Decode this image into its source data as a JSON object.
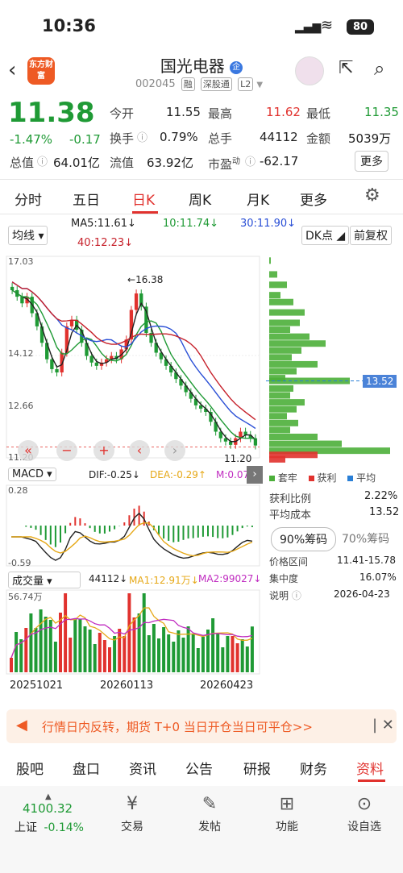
{
  "status": {
    "time": "10:36",
    "battery": "80"
  },
  "header": {
    "logo_text": "东方财富",
    "title": "国光电器",
    "title_badge": "企",
    "code": "002045",
    "tags": [
      "融",
      "深股通",
      "L2"
    ]
  },
  "quote": {
    "price": "11.38",
    "change_pct": "-1.47%",
    "change": "-0.17",
    "open_label": "今开",
    "open": "11.55",
    "high_label": "最高",
    "high": "11.62",
    "low_label": "最低",
    "low": "11.35",
    "turnover_label": "换手",
    "turnover": "0.79%",
    "volume_label": "总手",
    "volume": "44112",
    "amount_label": "金额",
    "amount": "5039万",
    "mcap_label": "总值",
    "mcap": "64.01亿",
    "float_label": "流值",
    "float": "63.92亿",
    "pe_label": "市盈",
    "pe_sup": "动",
    "pe": "-62.17",
    "more": "更多"
  },
  "tabs": [
    "分时",
    "五日",
    "日K",
    "周K",
    "月K",
    "更多"
  ],
  "active_tab": "日K",
  "ma_bar": {
    "select": "均线",
    "ma5": "MA5:11.61↓",
    "ma10": "10:11.74↓",
    "ma30": "30:11.90↓",
    "ma40": "40:12.23↓",
    "dk": "DK点",
    "adjust": "前复权"
  },
  "kline": {
    "y_top": "17.03",
    "y_mid": "14.12",
    "y_low": "12.66",
    "y_bot": "11.20",
    "peak_label": "16.38",
    "low_label": "11.20"
  },
  "macd": {
    "select": "MACD",
    "dif": "DIF:-0.25↓",
    "dea": "DEA:-0.29↑",
    "m": "M:0.07",
    "y_top": "0.28",
    "y_bot": "-0.59"
  },
  "vol": {
    "select": "成交量",
    "v": "44112↓",
    "ma1": "MA1:12.91万↓",
    "ma2": "MA2:99027↓",
    "y_top": "56.74万",
    "dates": [
      "20251021",
      "20260113",
      "20260423"
    ]
  },
  "chip": {
    "price_label": "13.52",
    "legend": [
      "套牢",
      "获利",
      "平均"
    ],
    "profit_label": "获利比例",
    "profit": "2.22%",
    "avg_label": "平均成本",
    "avg": "13.52",
    "tab90": "90%筹码",
    "tab70": "70%筹码",
    "range_label": "价格区间",
    "range": "11.41-15.78",
    "conc_label": "集中度",
    "conc": "16.07%",
    "note_label": "说明",
    "note": "2026-04-23"
  },
  "colors": {
    "up": "#e1322e",
    "down": "#1f9a35",
    "ma5": "#222222",
    "ma10": "#e6a817",
    "ma30": "#2a4fd6",
    "ma40": "#c6202a",
    "chip": "#4caf3a",
    "avg": "#2a7fd6"
  },
  "banner": {
    "text": "行情日内反转，期货 T+0 当日开仓当日可平仓>>"
  },
  "bottom_tabs": [
    "股吧",
    "盘口",
    "资讯",
    "公告",
    "研报",
    "财务",
    "资料"
  ],
  "active_bottom": "资料",
  "dock": {
    "index_value": "4100.32",
    "index_name": "上证",
    "index_change": "-0.14%",
    "items": [
      "交易",
      "发帖",
      "功能",
      "设自选"
    ]
  },
  "chart_data": {
    "type": "candlestick",
    "title": "",
    "ylim": [
      11.2,
      17.03
    ],
    "x_ticks": [
      "20251021",
      "20260113",
      "20260423"
    ],
    "close_path": [
      16.1,
      15.9,
      15.7,
      15.9,
      15.4,
      15.0,
      14.5,
      14.0,
      13.7,
      13.6,
      14.2,
      15.0,
      15.2,
      14.9,
      14.5,
      14.1,
      13.9,
      13.8,
      13.9,
      14.0,
      14.1,
      14.0,
      14.3,
      14.6,
      15.5,
      16.0,
      15.6,
      14.8,
      14.5,
      14.2,
      14.0,
      13.8,
      13.6,
      13.4,
      13.2,
      13.0,
      12.8,
      12.6,
      12.5,
      12.4,
      12.1,
      11.8,
      11.6,
      11.5,
      11.4,
      11.6,
      11.8,
      11.7,
      11.6,
      11.38
    ],
    "chip_avg": 13.52
  }
}
